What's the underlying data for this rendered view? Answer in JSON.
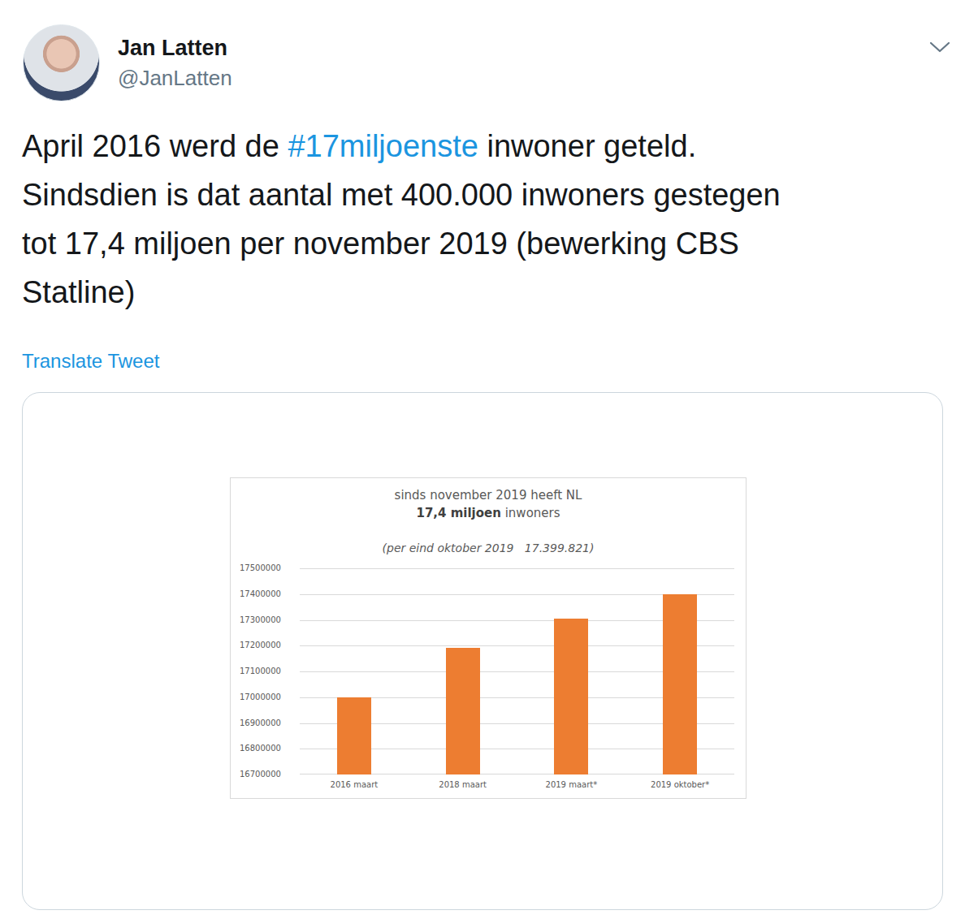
{
  "author": {
    "name": "Jan Latten",
    "handle": "@JanLatten"
  },
  "tweet": {
    "lines": [
      [
        {
          "text": "April 2016 werd de ",
          "kind": "text"
        },
        {
          "text": "#17miljoenste",
          "kind": "hashtag"
        },
        {
          "text": " inwoner geteld.",
          "kind": "text"
        }
      ],
      [
        {
          "text": "Sindsdien is dat aantal met 400.000 inwoners gestegen",
          "kind": "text"
        }
      ],
      [
        {
          "text": "tot 17,4 miljoen per november 2019 (bewerking CBS",
          "kind": "text"
        }
      ],
      [
        {
          "text": "Statline)",
          "kind": "text"
        }
      ]
    ]
  },
  "translate": "Translate Tweet",
  "chart": {
    "title": "sinds november 2019 heeft NL",
    "subtitle": {
      "bold": "17,4 miljoen",
      "rest": " inwoners"
    },
    "note": "(per eind oktober 2019   17.399.821)",
    "y_ticks": [
      "17500000",
      "17400000",
      "17300000",
      "17200000",
      "17100000",
      "17000000",
      "16900000",
      "16800000",
      "16700000"
    ],
    "categories": [
      "2016 maart",
      "2018 maart",
      "2019 maart*",
      "2019 oktober*"
    ],
    "series": [
      {
        "values": [
          17000000,
          17190000,
          17305000,
          17399821
        ]
      }
    ]
  }
}
